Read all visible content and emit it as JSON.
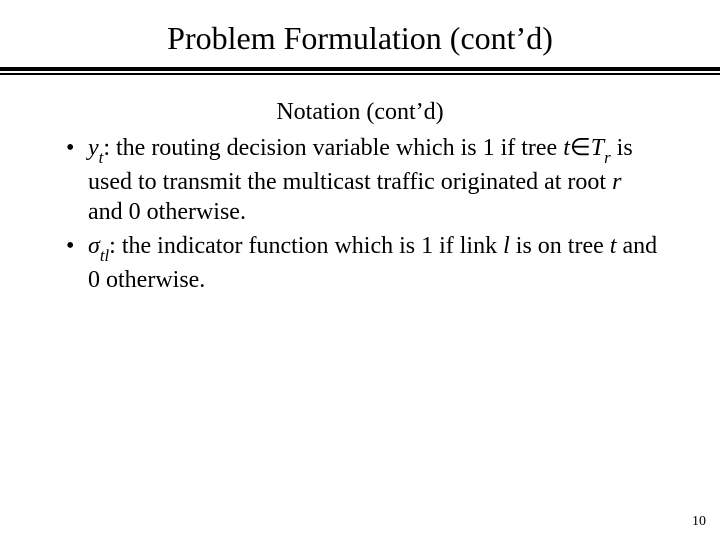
{
  "title": "Problem Formulation (cont’d)",
  "subhead": "Notation (cont’d)",
  "bullets": {
    "b1": {
      "var": "y",
      "varsub": "t",
      "text_a": ": the routing decision variable which is 1 if tree ",
      "t": "t",
      "in": "∈",
      "set": "T",
      "setsub": "r",
      "text_b": " is used to transmit the multicast traffic originated at root ",
      "root": "r",
      "text_c": " and 0 otherwise."
    },
    "b2": {
      "sigma": "σ",
      "sigsub": "tl",
      "text_a": ": the indicator function which is 1 if link ",
      "l": "l",
      "text_b": "  is on tree ",
      "t": "t",
      "text_c": " and 0 otherwise."
    }
  },
  "page": "10"
}
